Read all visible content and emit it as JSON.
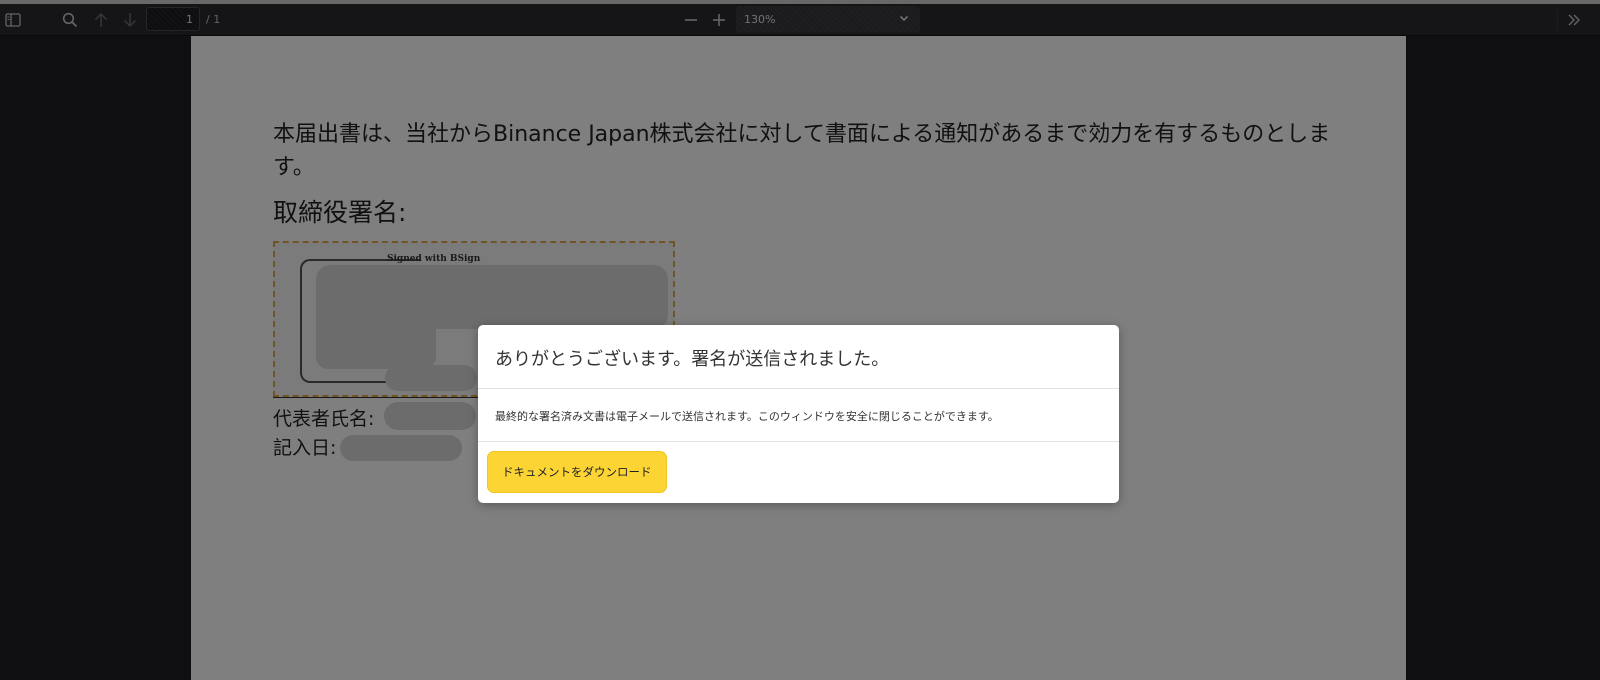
{
  "toolbar": {
    "page_number": "1",
    "page_total": "/ 1",
    "zoom": "130%"
  },
  "document": {
    "paragraph": "本届出書は、当社からBinance Japan株式会社に対して書面による通知があるまで効力を有するものとします。",
    "signature_heading": "取締役署名:",
    "signature_caption": "Signed with BSign",
    "representative_label": "代表者氏名:",
    "date_label": "記入日:"
  },
  "modal": {
    "title": "ありがとうございます。署名が送信されました。",
    "message": "最終的な署名済み文書は電子メールで送信されます。このウィンドウを安全に閉じることができます。",
    "download_button": "ドキュメントをダウンロード"
  },
  "icons": [
    "sidebar-toggle-icon",
    "search-icon",
    "arrow-up-icon",
    "arrow-down-icon",
    "zoom-out-icon",
    "zoom-in-icon",
    "chevron-down-icon",
    "double-chevron-right-icon"
  ],
  "colors": {
    "accent": "#fcd535"
  }
}
